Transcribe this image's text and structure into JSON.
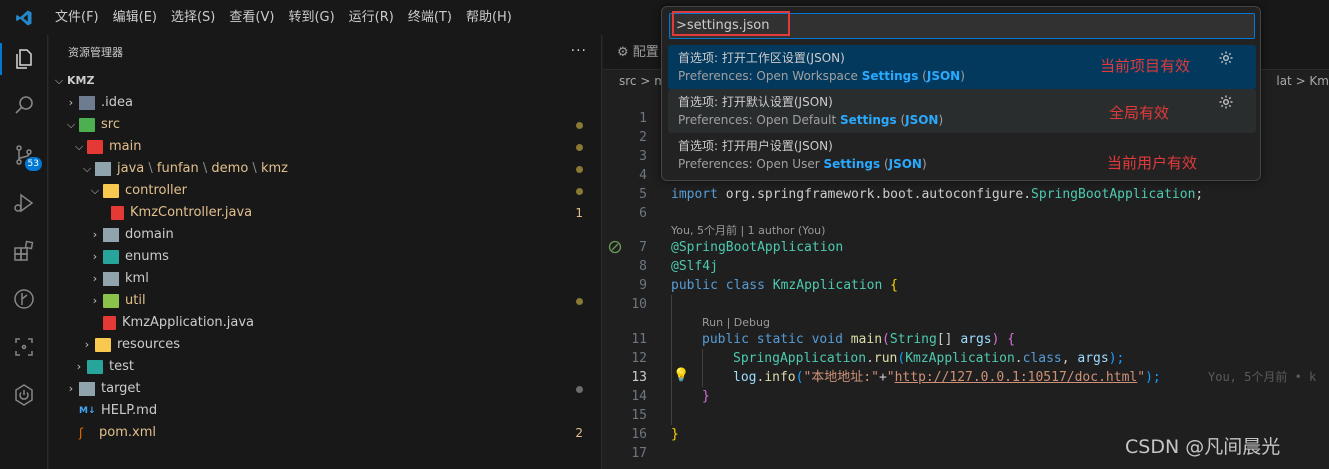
{
  "menu": [
    "文件(F)",
    "编辑(E)",
    "选择(S)",
    "查看(V)",
    "转到(G)",
    "运行(R)",
    "终端(T)",
    "帮助(H)"
  ],
  "activity": {
    "scm_badge": "53"
  },
  "explorer": {
    "title": "资源管理器",
    "more": "···",
    "root": "KMZ",
    "items": [
      {
        "label": ".idea",
        "color": "#cccccc"
      },
      {
        "label": "src",
        "color": "#e2c08d"
      },
      {
        "label": "main",
        "color": "#e2c08d"
      },
      {
        "label_parts": [
          "java",
          "funfan",
          "demo",
          "kmz"
        ],
        "color": "#e2c08d"
      },
      {
        "label": "controller",
        "color": "#e2c08d"
      },
      {
        "label": "KmzController.java",
        "color": "#e2c08d",
        "deco": "1"
      },
      {
        "label": "domain",
        "color": "#cccccc"
      },
      {
        "label": "enums",
        "color": "#cccccc"
      },
      {
        "label": "kml",
        "color": "#cccccc"
      },
      {
        "label": "util",
        "color": "#e2c08d"
      },
      {
        "label": "KmzApplication.java",
        "color": "#cccccc"
      },
      {
        "label": "resources",
        "color": "#cccccc"
      },
      {
        "label": "test",
        "color": "#cccccc"
      },
      {
        "label": "target",
        "color": "#cccccc"
      },
      {
        "label": "HELP.md",
        "color": "#cccccc"
      },
      {
        "label": "pom.xml",
        "color": "#e2c08d",
        "deco": "2"
      }
    ]
  },
  "editor": {
    "tab_label": "配置",
    "breadcrumb_left": "src > m",
    "breadcrumb_right": "lat > Km",
    "lines": [
      "1",
      "2",
      "3",
      "4",
      "5",
      "6",
      "7",
      "8",
      "9",
      "10",
      "11",
      "12",
      "13",
      "14",
      "15",
      "16",
      "17"
    ],
    "import_line": {
      "kw": "import",
      "pkg": "org.springframework.boot.autoconfigure.",
      "cls": "SpringBootApplication",
      "end": ";"
    },
    "lens_blame": "You, 5个月前 | 1 author (You)",
    "ann1": "@SpringBootApplication",
    "ann2": "@Slf4j",
    "class_line": {
      "kw1": "public",
      "kw2": "class",
      "name": "KmzApplication",
      "brace": "{"
    },
    "lens_run": "Run | Debug",
    "main_line": {
      "kw1": "public",
      "kw2": "static",
      "kw3": "void",
      "fn": "main",
      "p1": "(",
      "ptype": "String",
      "arr": "[]",
      "pname": "args",
      "p2": ") {"
    },
    "run_line": {
      "cls": "SpringApplication",
      "dot": ".",
      "fn": "run",
      "p1": "(",
      "arg1": "KmzApplication",
      "dot2": ".",
      "kw": "class",
      "comma": ", ",
      "arg2": "args",
      "end": ");"
    },
    "log_line": {
      "obj": "log",
      "dot": ".",
      "fn": "info",
      "p1": "(",
      "s1": "\"本地地址:\"",
      "plus": "+",
      "s2a": "\"",
      "url": "http://127.0.0.1:10517/doc.html",
      "s2b": "\"",
      "end": ");"
    },
    "inline_blame": "You, 5个月前 • k",
    "close_inner": "}",
    "close_outer": "}"
  },
  "palette": {
    "input_value": ">settings.json",
    "items": [
      {
        "title": "首选项: 打开工作区设置(JSON)",
        "sub_prefix": "Preferences: Open Workspace ",
        "hl1": "Settings",
        "mid": " (",
        "hl2": "JSON",
        "end": ")",
        "note": "当前项目有效"
      },
      {
        "title": "首选项: 打开默认设置(JSON)",
        "sub_prefix": "Preferences: Open Default ",
        "hl1": "Settings",
        "mid": " (",
        "hl2": "JSON",
        "end": ")",
        "note": "全局有效"
      },
      {
        "title": "首选项: 打开用户设置(JSON)",
        "sub_prefix": "Preferences: Open User ",
        "hl1": "Settings",
        "mid": " (",
        "hl2": "JSON",
        "end": ")",
        "note": "当前用户有效"
      }
    ]
  },
  "watermark": "CSDN @凡间晨光",
  "colors": {
    "accent": "#0078d4",
    "annotation_red": "#e03a3a"
  }
}
